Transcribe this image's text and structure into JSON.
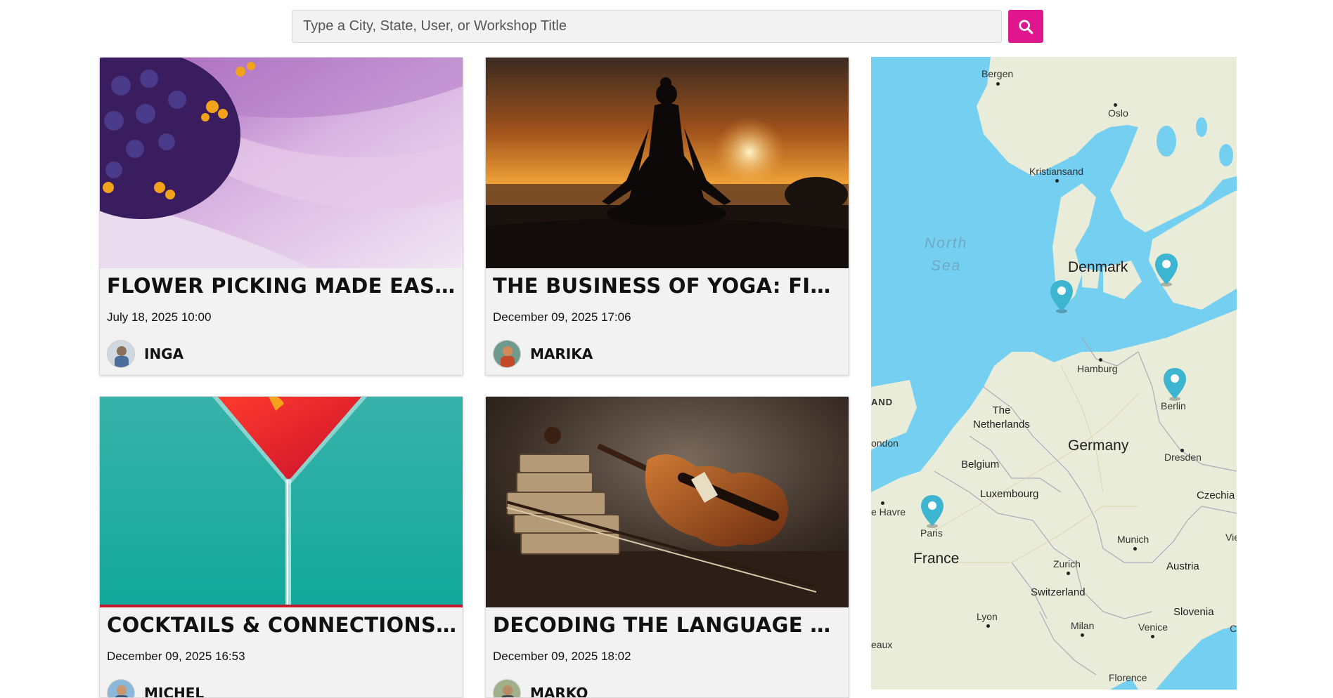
{
  "search": {
    "placeholder": "Type a City, State, User, or Workshop Title",
    "button_icon": "search-icon"
  },
  "colors": {
    "accent": "#e0168e",
    "card_bg": "#f2f2f2",
    "map_water": "#75cff0",
    "map_land": "#e9ecd8",
    "map_pin": "#3db5d0"
  },
  "workshops": [
    {
      "title": "FLOWER PICKING MADE EASY!",
      "date": "July 18, 2025 10:00",
      "user": "INGA",
      "image": "purple-flower-closeup"
    },
    {
      "title": "THE BUSINESS OF YOGA: FINDING...",
      "date": "December 09, 2025 17:06",
      "user": "MARIKA",
      "image": "yoga-sunset-silhouette"
    },
    {
      "title": "COCKTAILS & CONNECTIONS: A...",
      "date": "December 09, 2025 16:53",
      "user": "MICHEL",
      "image": "red-cocktail-glass"
    },
    {
      "title": "DECODING THE LANGUAGE OF...",
      "date": "December 09, 2025 18:02",
      "user": "MARKO",
      "image": "violin-and-books"
    }
  ],
  "map": {
    "seas": [
      {
        "name": "North\nSea"
      }
    ],
    "countries": [
      "Denmark",
      "Germany",
      "France",
      "The\nNetherlands",
      "Belgium",
      "Luxembourg",
      "Switzerland",
      "Austria",
      "Slovenia",
      "Czechia",
      "AND"
    ],
    "cities": [
      "Bergen",
      "Oslo",
      "Kristiansand",
      "Hamburg",
      "Berlin",
      "Dresden",
      "ondon",
      "e Havre",
      "Paris",
      "Munich",
      "Zurich",
      "Lyon",
      "Milan",
      "Venice",
      "Florence",
      "eaux",
      "Vie",
      "C"
    ],
    "pins": [
      {
        "label": "Copenhagen"
      },
      {
        "label": "Denmark west coast"
      },
      {
        "label": "Berlin"
      },
      {
        "label": "Paris"
      }
    ]
  }
}
